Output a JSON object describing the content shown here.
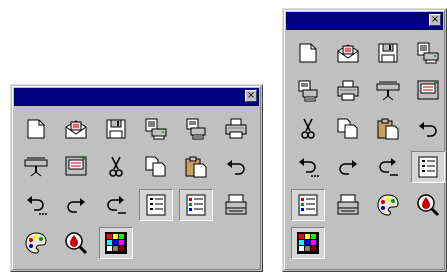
{
  "palettes": [
    {
      "close_glyph": "×",
      "buttons": [
        {
          "name": "new-document-icon",
          "pressed": false
        },
        {
          "name": "open-envelope-icon",
          "pressed": false
        },
        {
          "name": "save-floppy-icon",
          "pressed": false
        },
        {
          "name": "print-queue-icon",
          "pressed": false
        },
        {
          "name": "print-setup-icon",
          "pressed": false
        },
        {
          "name": "printer-icon",
          "pressed": false
        },
        {
          "name": "plotter-icon",
          "pressed": false
        },
        {
          "name": "large-printer-icon",
          "pressed": false
        },
        {
          "name": "scissors-cut-icon",
          "pressed": false
        },
        {
          "name": "copy-pages-icon",
          "pressed": false
        },
        {
          "name": "paste-clipboard-icon",
          "pressed": false
        },
        {
          "name": "undo-icon",
          "pressed": false
        },
        {
          "name": "undo-multiple-icon",
          "pressed": false
        },
        {
          "name": "redo-icon",
          "pressed": false
        },
        {
          "name": "redo-multiple-icon",
          "pressed": false
        },
        {
          "name": "form-list-icon",
          "pressed": true
        },
        {
          "name": "color-form-icon",
          "pressed": true
        },
        {
          "name": "paper-tray-icon",
          "pressed": false
        },
        {
          "name": "color-palette-icon",
          "pressed": false
        },
        {
          "name": "color-drop-zoom-icon",
          "pressed": false
        },
        {
          "name": "color-grid-icon",
          "pressed": true
        }
      ]
    },
    {
      "close_glyph": "×",
      "buttons": [
        {
          "name": "new-document-icon",
          "pressed": false
        },
        {
          "name": "open-envelope-icon",
          "pressed": false
        },
        {
          "name": "save-floppy-icon",
          "pressed": false
        },
        {
          "name": "print-queue-icon",
          "pressed": false
        },
        {
          "name": "print-setup-icon",
          "pressed": false
        },
        {
          "name": "printer-icon",
          "pressed": false
        },
        {
          "name": "plotter-icon",
          "pressed": false
        },
        {
          "name": "large-printer-icon",
          "pressed": false
        },
        {
          "name": "scissors-cut-icon",
          "pressed": false
        },
        {
          "name": "copy-pages-icon",
          "pressed": false
        },
        {
          "name": "paste-clipboard-icon",
          "pressed": false
        },
        {
          "name": "undo-icon",
          "pressed": false
        },
        {
          "name": "undo-multiple-icon",
          "pressed": false
        },
        {
          "name": "redo-icon",
          "pressed": false
        },
        {
          "name": "redo-multiple-icon",
          "pressed": false
        },
        {
          "name": "form-list-icon",
          "pressed": true
        },
        {
          "name": "color-form-icon",
          "pressed": true
        },
        {
          "name": "paper-tray-icon",
          "pressed": false
        },
        {
          "name": "color-palette-icon",
          "pressed": false
        },
        {
          "name": "color-drop-zoom-icon",
          "pressed": false
        },
        {
          "name": "color-grid-icon",
          "pressed": true
        }
      ]
    }
  ],
  "colors": {
    "titlebar": "#000080",
    "face": "#c0c0c0",
    "accent_red": "#cc0000",
    "accent_green": "#00a000",
    "accent_blue": "#0000cc",
    "accent_yellow": "#ffff00"
  }
}
